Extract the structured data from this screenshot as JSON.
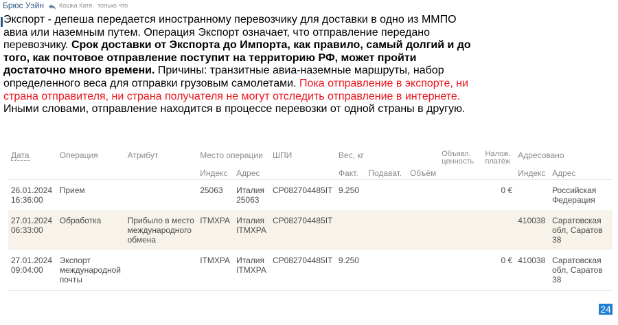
{
  "post": {
    "author": "Брюс Уэйн",
    "reply_target": "Кошка Катя",
    "time": "только что",
    "text_1": "Экспорт - депеша передается иностранному перевозчику для доставки в одно из ММПО авиа или наземным путем. Операция Экспорт означает, что отправление передано перевозчику. ",
    "text_bold": "Срок доставки от Экспорта до Импорта, как правило, самый долгий и до того, как почтовое отправление поступит на территорию РФ, может пройти достаточно много времени.",
    "text_2": " Причины: транзитные авиа-наземные маршруты, набор определенного веса для отправки грузовым самолетами. ",
    "text_red": "Пока отправление в экспорте, ни страна отправителя, ни страна получателя не могут отследить отправление в интернете.",
    "text_3": " Иными словами, отправление находится в процессе перевозки от одной страны в другую."
  },
  "table": {
    "headers": {
      "date": "Дата",
      "operation": "Операция",
      "attribute": "Атрибут",
      "place": "Место операции",
      "shpi": "ШПИ",
      "weight": "Вес, кг",
      "declared": "Объявл. ценность",
      "cod": "Налож. платёж",
      "addressed": "Адресовано"
    },
    "subheaders": {
      "index": "Индекс",
      "address": "Адрес",
      "actual": "Факт.",
      "submitted": "Подават.",
      "volume": "Объём",
      "index2": "Индекс",
      "address2": "Адрес"
    },
    "rows": [
      {
        "date": "26.01.2024 16:36:00",
        "operation": "Прием",
        "attribute": "",
        "index": "25063",
        "address": "Италия 25063",
        "shpi": "CP082704485IT",
        "weight_actual": "9.250",
        "weight_submitted": "",
        "volume": "",
        "declared": "",
        "cod": "0 €",
        "addr_index": "",
        "addr_address": "Российская Федерация"
      },
      {
        "date": "27.01.2024 06:33:00",
        "operation": "Обработка",
        "attribute": "Прибыло в место международного обмена",
        "index": "ITMXPA",
        "address": "Италия ITMXPA",
        "shpi": "CP082704485IT",
        "weight_actual": "",
        "weight_submitted": "",
        "volume": "",
        "declared": "",
        "cod": "",
        "addr_index": "410038",
        "addr_address": "Саратовская обл, Саратов 38"
      },
      {
        "date": "27.01.2024 09:04:00",
        "operation": "Экспорт международной почты",
        "attribute": "",
        "index": "ITMXPA",
        "address": "Италия ITMXPA",
        "shpi": "CP082704485IT",
        "weight_actual": "9.250",
        "weight_submitted": "",
        "volume": "",
        "declared": "",
        "cod": "0 €",
        "addr_index": "410038",
        "addr_address": "Саратовская обл, Саратов 38"
      }
    ]
  },
  "page_badge": "24",
  "colors": {
    "author": "#2a5885",
    "red_text": "#e8141c",
    "row_highlight": "#f7f3ea",
    "badge": "#1f7dd6"
  },
  "icons": {
    "reply": "reply-arrow-icon"
  }
}
